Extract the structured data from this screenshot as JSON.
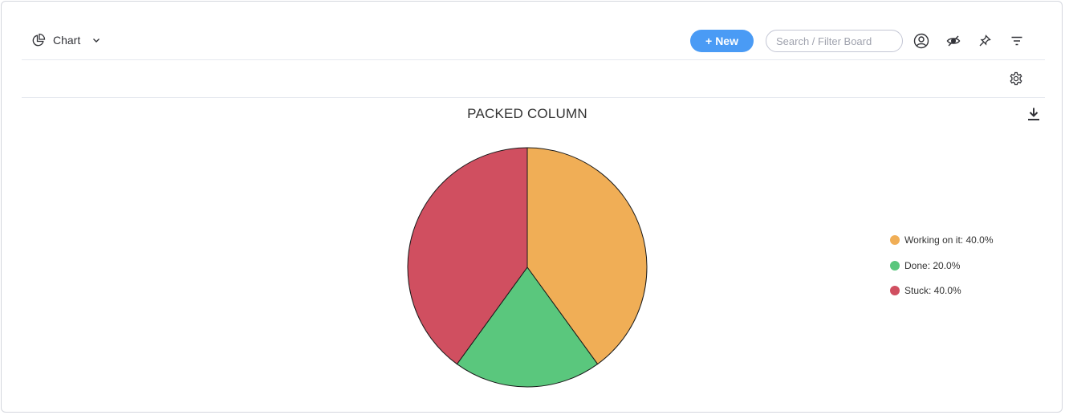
{
  "toolbar": {
    "view_label": "Chart",
    "new_label": "New",
    "new_plus": "+",
    "search_placeholder": "Search / Filter Board"
  },
  "icons": {
    "view": "pie-chart-icon",
    "view_dropdown": "chevron-down-icon",
    "person": "person-icon",
    "hide": "eye-hidden-icon",
    "pin": "pin-icon",
    "filter": "filter-icon",
    "settings": "gear-icon",
    "download": "download-icon"
  },
  "colors": {
    "accent": "#4a9bf5",
    "working": "#f0ae56",
    "done": "#5ac77d",
    "stuck": "#d04f60"
  },
  "chart_data": {
    "type": "pie",
    "title": "PACKED COLUMN",
    "series": [
      {
        "name": "Working on it",
        "value": 40.0,
        "color": "#f0ae56"
      },
      {
        "name": "Done",
        "value": 20.0,
        "color": "#5ac77d"
      },
      {
        "name": "Stuck",
        "value": 40.0,
        "color": "#d04f60"
      }
    ],
    "legend_labels": [
      "Working on it: 40.0%",
      "Done: 20.0%",
      "Stuck: 40.0%"
    ],
    "legend_position": "right"
  }
}
